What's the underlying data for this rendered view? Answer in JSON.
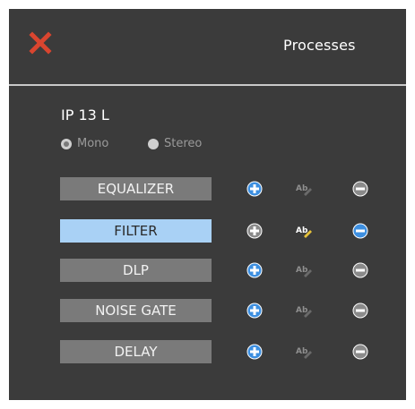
{
  "header": {
    "title": "Processes",
    "close_icon": "close-x-icon"
  },
  "device": {
    "name": "IP 13 L",
    "modes": [
      {
        "label": "Mono",
        "selected": true
      },
      {
        "label": "Stereo",
        "selected": false
      }
    ]
  },
  "processes": [
    {
      "label": "EQUALIZER",
      "selected": false,
      "add_enabled": true,
      "rename_enabled": false,
      "remove_enabled": false
    },
    {
      "label": "FILTER",
      "selected": true,
      "add_enabled": false,
      "rename_enabled": true,
      "remove_enabled": true
    },
    {
      "label": "DLP",
      "selected": false,
      "add_enabled": true,
      "rename_enabled": false,
      "remove_enabled": false
    },
    {
      "label": "NOISE GATE",
      "selected": false,
      "add_enabled": true,
      "rename_enabled": false,
      "remove_enabled": false
    },
    {
      "label": "DELAY",
      "selected": false,
      "add_enabled": true,
      "rename_enabled": false,
      "remove_enabled": false
    }
  ],
  "colors": {
    "background": "#3b3b3b",
    "item": "#7a7a7a",
    "item_selected": "#a9d1f5",
    "accent_blue": "#3d8fe0",
    "disabled": "#8a8a8a",
    "close_red": "#d9452f"
  }
}
